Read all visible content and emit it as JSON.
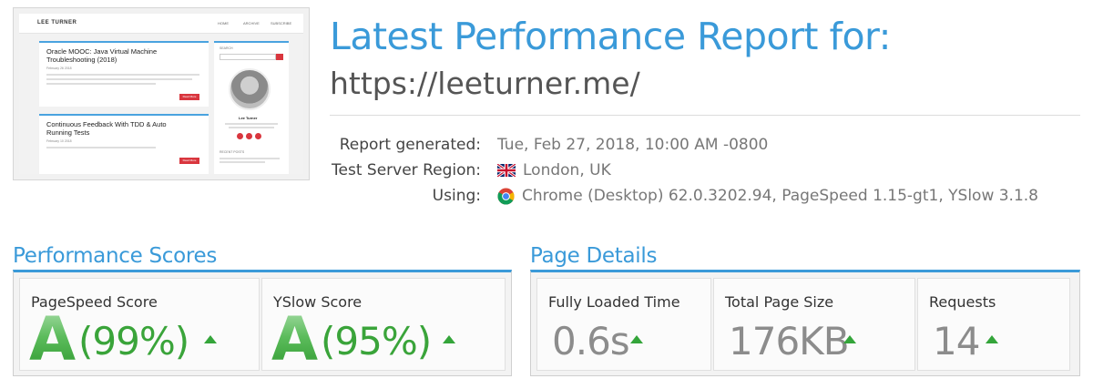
{
  "thumbnail": {
    "site_name": "LEE TURNER",
    "nav": [
      "HOME",
      "ARCHIVE",
      "SUBSCRIBE"
    ],
    "posts": [
      {
        "title": "Oracle MOOC: Java Virtual Machine Troubleshooting (2018)",
        "meta": "February 26 2018",
        "button": "Read More"
      },
      {
        "title": "Continuous Feedback With TDD & Auto Running Tests",
        "meta": "February 10 2018",
        "button": "Read More"
      }
    ],
    "sidebar": {
      "search_label": "SEARCH",
      "author": "Lee Turner",
      "recent_label": "RECENT POSTS"
    }
  },
  "header": {
    "title": "Latest Performance Report for:",
    "url": "https://leeturner.me/"
  },
  "info": {
    "generated_label": "Report generated:",
    "generated_value": "Tue, Feb 27, 2018, 10:00 AM -0800",
    "region_label": "Test Server Region:",
    "region_value": "London, UK",
    "region_icon": "uk-flag-icon",
    "using_label": "Using:",
    "using_value": "Chrome (Desktop) 62.0.3202.94, PageSpeed 1.15-gt1, YSlow 3.1.8",
    "using_icon": "chrome-icon"
  },
  "performance": {
    "title": "Performance Scores",
    "pagespeed": {
      "label": "PageSpeed Score",
      "grade": "A",
      "percent": "(99%)"
    },
    "yslow": {
      "label": "YSlow Score",
      "grade": "A",
      "percent": "(95%)"
    }
  },
  "details": {
    "title": "Page Details",
    "loaded": {
      "label": "Fully Loaded Time",
      "value": "0.6s"
    },
    "size": {
      "label": "Total Page Size",
      "value": "176KB"
    },
    "requests": {
      "label": "Requests",
      "value": "14"
    }
  },
  "colors": {
    "accent": "#3a9ad9",
    "good": "#3aa43a",
    "neutral_value": "#8c8c8c",
    "arrow": "#34a53a"
  }
}
